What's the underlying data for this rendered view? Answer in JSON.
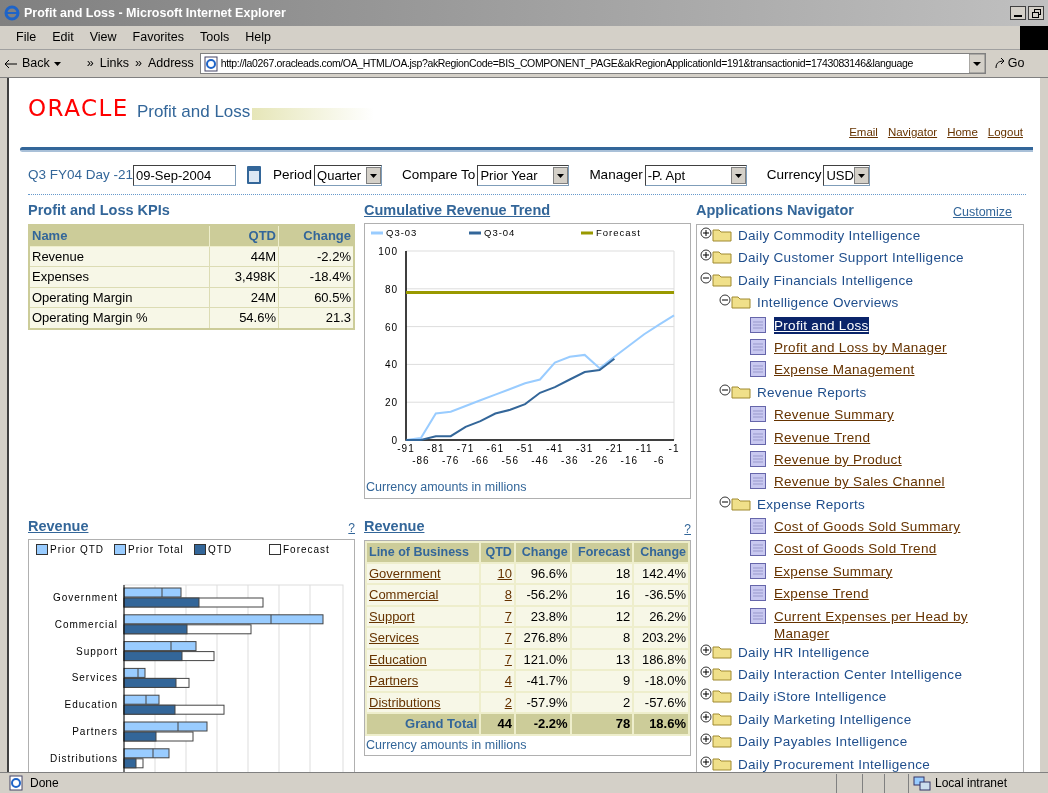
{
  "window": {
    "title": "Profit and Loss - Microsoft Internet Explorer"
  },
  "menu": [
    "File",
    "Edit",
    "View",
    "Favorites",
    "Tools",
    "Help"
  ],
  "toolbar": {
    "back": "Back",
    "chevron_1": "»",
    "links": "Links",
    "chevron_2": "»",
    "address_label": "Address",
    "address": "http://la0267.oracleads.com/OA_HTML/OA.jsp?akRegionCode=BIS_COMPONENT_PAGE&akRegionApplicationId=191&transactionid=1743083146&language",
    "go": "Go"
  },
  "header": {
    "logo": "ORACLE",
    "title": "Profit and Loss",
    "links": [
      "Email",
      "Navigator",
      "Home",
      "Logout"
    ]
  },
  "filters": {
    "date_label": "Q3 FY04 Day -21",
    "date": "09-Sep-2004",
    "selects": [
      {
        "label": "Period",
        "value": "Quarter"
      },
      {
        "label": "Compare To",
        "value": "Prior Year"
      },
      {
        "label": "Manager",
        "value": "-P. Apt"
      },
      {
        "label": "Currency",
        "value": "USD"
      }
    ]
  },
  "kpis": {
    "title": "Profit and Loss KPIs",
    "columns": [
      "Name",
      "QTD",
      "Change"
    ],
    "rows": [
      [
        "Revenue",
        "44M",
        "-2.2%"
      ],
      [
        "Expenses",
        "3,498K",
        "-18.4%"
      ],
      [
        "Operating Margin",
        "24M",
        "60.5%"
      ],
      [
        "Operating Margin %",
        "54.6%",
        "21.3"
      ]
    ]
  },
  "trend": {
    "title": "Cumulative Revenue Trend",
    "footnote": "Currency amounts in millions",
    "chart_data": {
      "type": "line",
      "x": [
        -91,
        -86,
        -81,
        -76,
        -71,
        -66,
        -61,
        -56,
        -51,
        -46,
        -41,
        -36,
        -31,
        -26,
        -21,
        -16,
        -11,
        -6,
        -1
      ],
      "xlim": [
        -91,
        -1
      ],
      "ylim": [
        0,
        100
      ],
      "yticks": [
        0,
        20,
        40,
        60,
        80,
        100
      ],
      "xticks": [
        -91,
        -81,
        -71,
        -61,
        -51,
        -41,
        -31,
        -21,
        -11,
        -1
      ],
      "grid": true,
      "legend": true,
      "annotations": [
        "-86",
        "-76",
        "-66",
        "-56",
        "-46",
        "-36",
        "-26",
        "-16",
        "-6"
      ],
      "series": [
        {
          "name": "Q3-03",
          "color": "#99ccff",
          "values": [
            0,
            1,
            14,
            15,
            18,
            21,
            24,
            27,
            30,
            32,
            41,
            44,
            45,
            38,
            44,
            50,
            56,
            61,
            66
          ]
        },
        {
          "name": "Q3-04",
          "color": "#336699",
          "values": [
            0,
            0,
            2,
            2,
            7,
            10,
            14,
            16,
            19,
            25,
            28,
            32,
            36,
            37,
            43,
            null,
            null,
            null,
            null
          ]
        },
        {
          "name": "Forecast",
          "color": "#999900",
          "values": [
            78,
            78,
            78,
            78,
            78,
            78,
            78,
            78,
            78,
            78,
            78,
            78,
            78,
            78,
            78,
            78,
            78,
            78,
            78
          ]
        }
      ]
    }
  },
  "revenue_chart": {
    "title": "Revenue",
    "help": "?",
    "legend": [
      {
        "label": "Prior QTD",
        "color": "#99ccff"
      },
      {
        "label": "Prior Total",
        "color": "#99ccff"
      },
      {
        "label": "QTD",
        "color": "#336699"
      },
      {
        "label": "Forecast",
        "color": "#ffffff"
      }
    ],
    "categories": [
      "Government",
      "Commercial",
      "Support",
      "Services",
      "Education",
      "Partners",
      "Distributions"
    ]
  },
  "revenue_table": {
    "title": "Revenue",
    "help": "?",
    "columns": [
      "Line of Business",
      "QTD",
      "Change",
      "Forecast",
      "Change"
    ],
    "rows": [
      [
        "Government",
        "10",
        "96.6%",
        "18",
        "142.4%"
      ],
      [
        "Commercial",
        "8",
        "-56.2%",
        "16",
        "-36.5%"
      ],
      [
        "Support",
        "7",
        "23.8%",
        "12",
        "26.2%"
      ],
      [
        "Services",
        "7",
        "276.8%",
        "8",
        "203.2%"
      ],
      [
        "Education",
        "7",
        "121.0%",
        "13",
        "186.8%"
      ],
      [
        "Partners",
        "4",
        "-41.7%",
        "9",
        "-18.0%"
      ],
      [
        "Distributions",
        "2",
        "-57.9%",
        "2",
        "-57.6%"
      ]
    ],
    "total": [
      "Grand Total",
      "44",
      "-2.2%",
      "78",
      "18.6%"
    ],
    "footnote": "Currency amounts in millions"
  },
  "navigator": {
    "title": "Applications Navigator",
    "customize": "Customize",
    "items": [
      {
        "kind": "folder",
        "label": "Daily Commodity Intelligence",
        "expanded": false
      },
      {
        "kind": "folder",
        "label": "Daily Customer Support Intelligence",
        "expanded": false
      },
      {
        "kind": "folder",
        "label": "Daily Financials Intelligence",
        "expanded": true,
        "children": [
          {
            "kind": "folder",
            "label": "Intelligence Overviews",
            "expanded": true,
            "children": [
              {
                "kind": "report",
                "label": "Profit and Loss",
                "selected": true
              },
              {
                "kind": "report",
                "label": "Profit and Loss by Manager",
                "selected": false
              },
              {
                "kind": "report",
                "label": "Expense Management",
                "selected": false
              }
            ]
          },
          {
            "kind": "folder",
            "label": "Revenue Reports",
            "expanded": true,
            "children": [
              {
                "kind": "report",
                "label": "Revenue Summary",
                "selected": false
              },
              {
                "kind": "report",
                "label": "Revenue Trend",
                "selected": false
              },
              {
                "kind": "report",
                "label": "Revenue by Product",
                "selected": false
              },
              {
                "kind": "report",
                "label": "Revenue by Sales Channel",
                "selected": false
              }
            ]
          },
          {
            "kind": "folder",
            "label": "Expense Reports",
            "expanded": true,
            "children": [
              {
                "kind": "report",
                "label": "Cost of Goods Sold Summary",
                "selected": false
              },
              {
                "kind": "report",
                "label": "Cost of Goods Sold Trend",
                "selected": false
              },
              {
                "kind": "report",
                "label": "Expense Summary",
                "selected": false
              },
              {
                "kind": "report",
                "label": "Expense Trend",
                "selected": false
              },
              {
                "kind": "report",
                "label": "Current Expenses per Head by Manager",
                "selected": false
              }
            ]
          }
        ]
      },
      {
        "kind": "folder",
        "label": "Daily HR Intelligence",
        "expanded": false
      },
      {
        "kind": "folder",
        "label": "Daily Interaction Center Intelligence",
        "expanded": false
      },
      {
        "kind": "folder",
        "label": "Daily iStore Intelligence",
        "expanded": false
      },
      {
        "kind": "folder",
        "label": "Daily Marketing Intelligence",
        "expanded": false
      },
      {
        "kind": "folder",
        "label": "Daily Payables Intelligence",
        "expanded": false
      },
      {
        "kind": "folder",
        "label": "Daily Procurement Intelligence",
        "expanded": false
      }
    ]
  },
  "status_bar": {
    "text": "Done",
    "zone": "Local intranet"
  }
}
